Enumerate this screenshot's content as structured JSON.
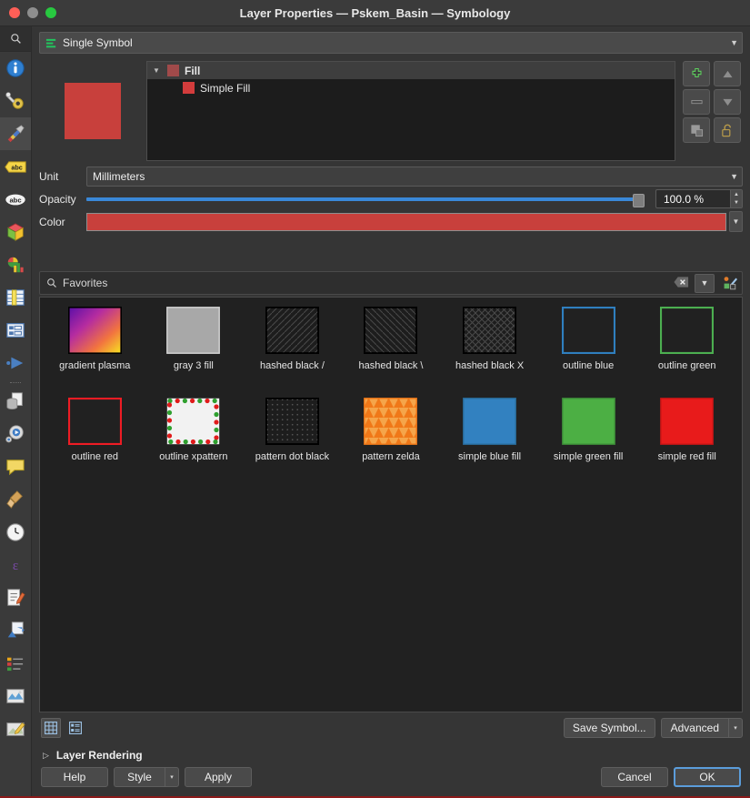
{
  "window": {
    "title": "Layer Properties — Pskem_Basin — Symbology",
    "traffic_lights": [
      "close",
      "minimize",
      "zoom"
    ]
  },
  "sidebar": {
    "search_icon": "search-icon",
    "items": [
      {
        "name": "information",
        "icon": "info-icon",
        "active": false
      },
      {
        "name": "source",
        "icon": "wrench-gear-icon",
        "active": false
      },
      {
        "name": "symbology",
        "icon": "paintbrush-icon",
        "active": true
      },
      {
        "name": "labels",
        "icon": "abc-tag-icon",
        "active": false
      },
      {
        "name": "masks",
        "icon": "abc-cloud-icon",
        "active": false
      },
      {
        "name": "3d-view",
        "icon": "cube-icon",
        "active": false
      },
      {
        "name": "diagrams",
        "icon": "pie-bar-chart-icon",
        "active": false
      },
      {
        "name": "fields",
        "icon": "table-ruler-icon",
        "active": false
      },
      {
        "name": "attributes-form",
        "icon": "form-layout-icon",
        "active": false
      },
      {
        "name": "joins",
        "icon": "join-arrow-icon",
        "active": false
      },
      {
        "name": "auxiliary-storage",
        "icon": "database-page-icon",
        "active": false
      },
      {
        "name": "actions",
        "icon": "gear-play-icon",
        "active": false
      },
      {
        "name": "display",
        "icon": "speech-bubble-icon",
        "active": false
      },
      {
        "name": "rendering",
        "icon": "broom-icon",
        "active": false
      },
      {
        "name": "temporal",
        "icon": "clock-icon",
        "active": false
      },
      {
        "name": "variables",
        "icon": "epsilon-icon",
        "active": false
      },
      {
        "name": "metadata",
        "icon": "document-pencil-icon",
        "active": false
      },
      {
        "name": "dependencies",
        "icon": "sync-arrows-icon",
        "active": false
      },
      {
        "name": "legend",
        "icon": "legend-list-icon",
        "active": false
      },
      {
        "name": "qgis-server",
        "icon": "map-image-icon",
        "active": false
      },
      {
        "name": "digitizing",
        "icon": "map-pencil-icon",
        "active": false
      }
    ]
  },
  "renderer": {
    "label": "Single Symbol",
    "icon": "single-symbol-icon",
    "arrow": "▼"
  },
  "symbol_tree": {
    "preview_color": "#c8403c",
    "nodes": [
      {
        "label": "Fill",
        "color": "#a04a4a",
        "selected": true,
        "expanded": true,
        "level": 0
      },
      {
        "label": "Simple Fill",
        "color": "#d33c3c",
        "selected": false,
        "expanded": false,
        "level": 1
      }
    ],
    "buttons": [
      {
        "name": "add-symbol-layer",
        "icon": "plus-icon"
      },
      {
        "name": "move-up",
        "icon": "arrow-up-icon"
      },
      {
        "name": "remove-symbol-layer",
        "icon": "minus-icon"
      },
      {
        "name": "move-down",
        "icon": "arrow-down-icon"
      },
      {
        "name": "duplicate-symbol-layer",
        "icon": "duplicate-icon"
      },
      {
        "name": "lock-layer-colors",
        "icon": "unlocked-padlock-icon"
      }
    ]
  },
  "properties": {
    "unit_label": "Unit",
    "unit_value": "Millimeters",
    "opacity_label": "Opacity",
    "opacity_value": "100.0 %",
    "opacity_percent": 100,
    "color_label": "Color",
    "color_value": "#c8403c"
  },
  "browser": {
    "search_placeholder": "Favorites",
    "search_icon": "search-icon",
    "clear_icon": "clear-x-icon",
    "filter_arrow": "▼",
    "style_manager_icon": "style-manager-icon",
    "symbols": [
      {
        "label": "gradient  plasma",
        "style": "gradient-plasma"
      },
      {
        "label": "gray 3 fill",
        "style": "gray-fill",
        "fill": "#a8a8a8",
        "stroke": "#d6d6d6"
      },
      {
        "label": "hashed black /",
        "style": "hatch-forward",
        "fill": "#1d1d1d",
        "stroke": "#000000"
      },
      {
        "label": "hashed black \\",
        "style": "hatch-back",
        "fill": "#1d1d1d",
        "stroke": "#000000"
      },
      {
        "label": "hashed black X",
        "style": "hatch-cross",
        "fill": "#1d1d1d",
        "stroke": "#000000"
      },
      {
        "label": "outline blue",
        "style": "outline",
        "fill": "transparent",
        "stroke": "#2f7fbf"
      },
      {
        "label": "outline green",
        "style": "outline",
        "fill": "transparent",
        "stroke": "#4caf50"
      },
      {
        "label": "outline red",
        "style": "outline",
        "fill": "transparent",
        "stroke": "#ee1c24"
      },
      {
        "label": "outline xpattern",
        "style": "outline-xpattern",
        "fill": "#f2f2f2",
        "stroke": "#ffffff"
      },
      {
        "label": "pattern dot black",
        "style": "dot-pattern",
        "fill": "#1d1d1d",
        "stroke": "#000000"
      },
      {
        "label": "pattern zelda",
        "style": "zelda-pattern",
        "fill": "#f5a54a",
        "stroke": "#f07818"
      },
      {
        "label": "simple blue fill",
        "style": "solid",
        "fill": "#3281c0",
        "stroke": "#2a6e9e"
      },
      {
        "label": "simple green fill",
        "style": "solid",
        "fill": "#4caf44",
        "stroke": "#3d8c38"
      },
      {
        "label": "simple red fill",
        "style": "solid",
        "fill": "#e81b1b",
        "stroke": "#c41515"
      }
    ],
    "view_grid_icon": "grid-view-icon",
    "view_list_icon": "list-view-icon",
    "save_symbol_label": "Save Symbol...",
    "advanced_label": "Advanced",
    "advanced_arrow": "▾"
  },
  "layer_rendering": {
    "label": "Layer Rendering",
    "collapsed_arrow": "▷"
  },
  "dialog_buttons": {
    "help": "Help",
    "style": "Style",
    "style_arrow": "▾",
    "apply": "Apply",
    "cancel": "Cancel",
    "ok": "OK"
  }
}
